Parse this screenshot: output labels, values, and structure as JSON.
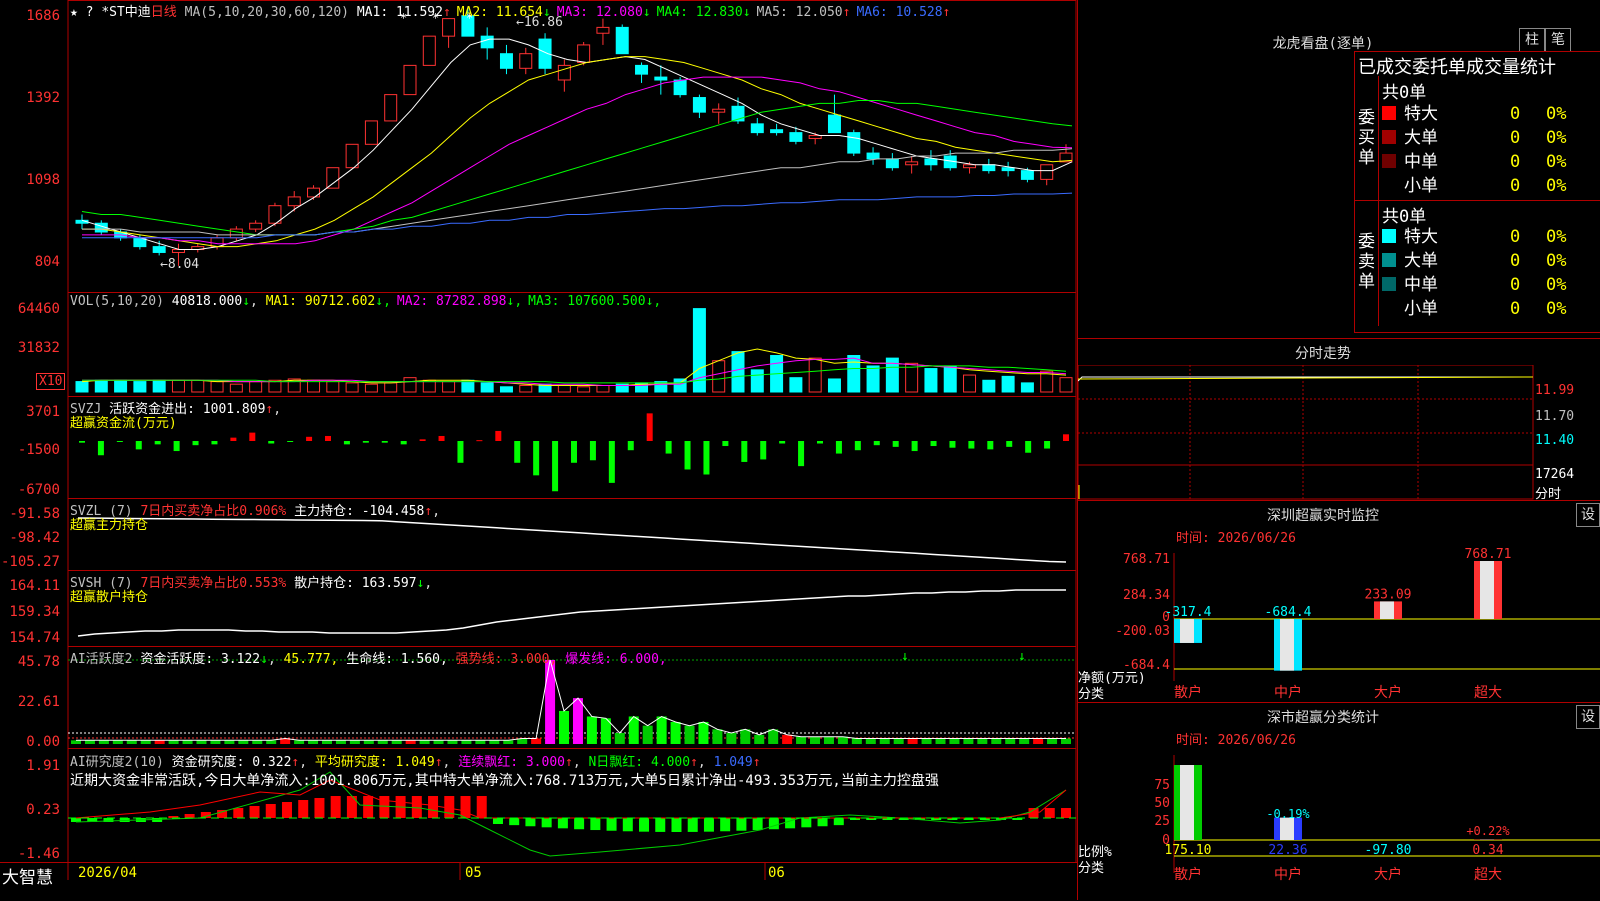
{
  "app": {
    "brand": "大智慧",
    "top_icons": "★ ?"
  },
  "colors": {
    "up": "#ff3232",
    "down": "#00ffff",
    "ma1": "#ffffff",
    "ma2": "#ffff00",
    "ma3": "#ff00ff",
    "ma4": "#00ff00",
    "ma5": "#c0c0c0",
    "ma6": "#3a6bff",
    "border": "#b00000"
  },
  "kline": {
    "stock": "*ST中迪",
    "period": "日线",
    "ma_header": "MA(5,10,20,30,60,120)",
    "ma_values": [
      {
        "label": "MA1:",
        "value": "11.592",
        "arrow": "↑"
      },
      {
        "label": "MA2:",
        "value": "11.654",
        "arrow": "↓"
      },
      {
        "label": "MA3:",
        "value": "12.080",
        "arrow": "↓"
      },
      {
        "label": "MA4:",
        "value": "12.830",
        "arrow": "↓"
      },
      {
        "label": "MA5:",
        "value": "12.050",
        "arrow": "↑"
      },
      {
        "label": "MA6:",
        "value": "10.528",
        "arrow": "↑"
      }
    ],
    "y_labels": [
      "1686",
      "1392",
      "1098",
      "804"
    ],
    "high_mark": "16.86",
    "low_mark": "8.04",
    "candles": [
      [
        9.6,
        9.8,
        9.3,
        9.5
      ],
      [
        9.5,
        9.6,
        9.1,
        9.2
      ],
      [
        9.2,
        9.3,
        8.9,
        9.0
      ],
      [
        9.0,
        9.1,
        8.6,
        8.7
      ],
      [
        8.7,
        8.9,
        8.4,
        8.5
      ],
      [
        8.5,
        8.8,
        8.04,
        8.6
      ],
      [
        8.6,
        8.8,
        8.5,
        8.7
      ],
      [
        8.7,
        9.1,
        8.6,
        9.0
      ],
      [
        9.0,
        9.4,
        8.9,
        9.3
      ],
      [
        9.3,
        9.6,
        9.2,
        9.5
      ],
      [
        9.5,
        10.2,
        9.4,
        10.1
      ],
      [
        10.1,
        10.6,
        9.9,
        10.4
      ],
      [
        10.4,
        10.8,
        10.3,
        10.7
      ],
      [
        10.7,
        11.4,
        10.7,
        11.4
      ],
      [
        11.4,
        12.2,
        11.4,
        12.2
      ],
      [
        12.2,
        13.0,
        12.2,
        13.0
      ],
      [
        13.0,
        13.9,
        13.0,
        13.9
      ],
      [
        13.9,
        14.9,
        13.9,
        14.9
      ],
      [
        14.9,
        15.9,
        14.9,
        15.9
      ],
      [
        15.9,
        16.5,
        15.5,
        16.5
      ],
      [
        16.6,
        16.86,
        15.9,
        15.9
      ],
      [
        15.9,
        16.2,
        15.1,
        15.5
      ],
      [
        15.3,
        15.6,
        14.6,
        14.8
      ],
      [
        14.8,
        15.5,
        14.6,
        15.3
      ],
      [
        15.8,
        16.0,
        14.6,
        14.8
      ],
      [
        14.4,
        15.1,
        14.0,
        14.9
      ],
      [
        15.0,
        15.7,
        14.9,
        15.6
      ],
      [
        16.0,
        16.5,
        15.6,
        16.2
      ],
      [
        16.2,
        16.3,
        15.3,
        15.3
      ],
      [
        14.9,
        15.0,
        14.3,
        14.6
      ],
      [
        14.5,
        14.9,
        13.9,
        14.4
      ],
      [
        14.4,
        14.5,
        13.8,
        13.9
      ],
      [
        13.8,
        13.9,
        13.1,
        13.3
      ],
      [
        13.3,
        13.6,
        12.9,
        13.4
      ],
      [
        13.5,
        13.8,
        12.9,
        13.0
      ],
      [
        12.9,
        13.1,
        12.5,
        12.6
      ],
      [
        12.7,
        12.9,
        12.5,
        12.6
      ],
      [
        12.6,
        12.8,
        12.2,
        12.3
      ],
      [
        12.4,
        12.6,
        12.2,
        12.5
      ],
      [
        13.2,
        13.9,
        12.6,
        12.6
      ],
      [
        12.6,
        12.7,
        11.8,
        11.9
      ],
      [
        11.9,
        12.1,
        11.5,
        11.7
      ],
      [
        11.7,
        11.9,
        11.3,
        11.4
      ],
      [
        11.5,
        11.8,
        11.2,
        11.6
      ],
      [
        11.7,
        12.0,
        11.3,
        11.5
      ],
      [
        11.8,
        12.0,
        11.3,
        11.4
      ],
      [
        11.4,
        11.6,
        11.2,
        11.5
      ],
      [
        11.5,
        11.7,
        11.2,
        11.3
      ],
      [
        11.4,
        11.6,
        11.1,
        11.3
      ],
      [
        11.3,
        11.4,
        10.9,
        11.0
      ],
      [
        11.0,
        11.5,
        10.8,
        11.5
      ],
      [
        11.6,
        12.2,
        11.6,
        11.9
      ]
    ],
    "ma_series": {
      "ma1": [
        9.6,
        9.4,
        9.2,
        9.0,
        8.8,
        8.6,
        8.6,
        8.7,
        8.9,
        9.1,
        9.5,
        10.0,
        10.4,
        10.9,
        11.4,
        12.0,
        12.7,
        13.4,
        14.2,
        15.0,
        15.6,
        15.8,
        15.8,
        15.6,
        15.3,
        15.1,
        15.0,
        15.1,
        15.2,
        15.1,
        14.8,
        14.5,
        14.2,
        13.9,
        13.6,
        13.2,
        12.9,
        12.7,
        12.5,
        12.5,
        12.4,
        12.2,
        12.0,
        11.8,
        11.7,
        11.6,
        11.5,
        11.5,
        11.4,
        11.3,
        11.3,
        11.6
      ],
      "ma2": [
        9.3,
        9.3,
        9.2,
        9.1,
        9.0,
        8.9,
        8.8,
        8.7,
        8.7,
        8.8,
        8.9,
        9.1,
        9.3,
        9.6,
        10.0,
        10.4,
        10.9,
        11.4,
        11.9,
        12.5,
        13.1,
        13.6,
        14.0,
        14.4,
        14.6,
        14.8,
        15.0,
        15.1,
        15.2,
        15.2,
        15.1,
        15.0,
        14.8,
        14.6,
        14.4,
        14.1,
        13.9,
        13.6,
        13.4,
        13.2,
        13.0,
        12.8,
        12.6,
        12.4,
        12.3,
        12.1,
        12.0,
        11.9,
        11.8,
        11.7,
        11.6,
        11.65
      ],
      "ma3": [
        9.1,
        9.1,
        9.1,
        9.0,
        9.0,
        8.9,
        8.9,
        8.8,
        8.8,
        8.8,
        8.8,
        8.8,
        8.9,
        9.1,
        9.3,
        9.6,
        9.9,
        10.2,
        10.6,
        11.0,
        11.4,
        11.8,
        12.2,
        12.5,
        12.8,
        13.1,
        13.4,
        13.6,
        13.9,
        14.1,
        14.3,
        14.4,
        14.5,
        14.5,
        14.5,
        14.5,
        14.4,
        14.3,
        14.1,
        14.0,
        13.8,
        13.6,
        13.4,
        13.2,
        13.0,
        12.8,
        12.6,
        12.5,
        12.3,
        12.2,
        12.1,
        12.08
      ],
      "ma4": [
        9.9,
        9.8,
        9.8,
        9.7,
        9.6,
        9.5,
        9.4,
        9.3,
        9.2,
        9.1,
        9.1,
        9.1,
        9.1,
        9.2,
        9.3,
        9.4,
        9.6,
        9.7,
        9.9,
        10.1,
        10.3,
        10.5,
        10.7,
        10.9,
        11.1,
        11.3,
        11.5,
        11.7,
        11.9,
        12.1,
        12.3,
        12.5,
        12.7,
        12.9,
        13.1,
        13.3,
        13.4,
        13.5,
        13.6,
        13.6,
        13.7,
        13.7,
        13.6,
        13.6,
        13.5,
        13.4,
        13.3,
        13.2,
        13.1,
        13.0,
        12.9,
        12.83
      ],
      "ma5": [
        9.3,
        9.3,
        9.3,
        9.2,
        9.2,
        9.2,
        9.2,
        9.1,
        9.1,
        9.1,
        9.1,
        9.1,
        9.1,
        9.2,
        9.2,
        9.3,
        9.4,
        9.5,
        9.6,
        9.7,
        9.8,
        9.9,
        10.0,
        10.1,
        10.2,
        10.3,
        10.4,
        10.5,
        10.6,
        10.7,
        10.8,
        10.9,
        11.0,
        11.1,
        11.2,
        11.3,
        11.4,
        11.4,
        11.5,
        11.6,
        11.6,
        11.7,
        11.7,
        11.8,
        11.8,
        11.9,
        11.9,
        11.9,
        12.0,
        12.0,
        12.0,
        12.05
      ],
      "ma6": [
        9.0,
        9.0,
        9.0,
        9.0,
        9.0,
        9.0,
        9.0,
        9.0,
        9.0,
        9.0,
        9.1,
        9.1,
        9.1,
        9.2,
        9.2,
        9.3,
        9.3,
        9.4,
        9.4,
        9.5,
        9.5,
        9.6,
        9.6,
        9.7,
        9.7,
        9.8,
        9.8,
        9.85,
        9.9,
        9.95,
        10.0,
        10.0,
        10.05,
        10.1,
        10.1,
        10.15,
        10.2,
        10.2,
        10.25,
        10.3,
        10.3,
        10.3,
        10.35,
        10.4,
        10.4,
        10.4,
        10.45,
        10.45,
        10.5,
        10.5,
        10.5,
        10.53
      ]
    }
  },
  "vol": {
    "header": "VOL(5,10,20)",
    "val": "40818.000",
    "ma": [
      {
        "label": "MA1:",
        "value": "90712.602",
        "arrow": "↓"
      },
      {
        "label": "MA2:",
        "value": "87282.898",
        "arrow": "↓"
      },
      {
        "label": "MA3:",
        "value": "107600.500",
        "arrow": "↓"
      }
    ],
    "y_labels": [
      "64460",
      "31832"
    ],
    "unit": "X10",
    "bars": [
      8,
      9,
      9,
      8,
      9,
      9,
      9,
      8,
      6,
      8,
      9,
      10,
      9,
      8,
      7,
      6,
      7,
      11,
      9,
      8,
      9,
      7,
      4,
      5,
      6,
      5,
      4,
      5,
      6,
      7,
      8,
      10,
      64,
      24,
      31,
      17,
      28,
      11,
      26,
      10,
      28,
      20,
      26,
      22,
      18,
      20,
      13,
      9,
      12,
      7,
      16,
      11
    ]
  },
  "svzj": {
    "header": "SVZJ",
    "line1": "活跃资金进出: 1001.809",
    "line2": "超赢资金流(万元)",
    "y_labels": [
      "3701",
      "-1500",
      "-6700"
    ],
    "values": [
      -200,
      -1700,
      -100,
      -1000,
      -400,
      -1200,
      -500,
      -400,
      400,
      1000,
      -300,
      -100,
      500,
      600,
      -400,
      -200,
      -200,
      -400,
      200,
      600,
      -2600,
      100,
      1200,
      -2600,
      -4100,
      -6000,
      -2600,
      -2300,
      -5000,
      -1100,
      3300,
      -1500,
      -3400,
      -4000,
      -600,
      -2500,
      -2200,
      -300,
      -3000,
      -300,
      -1500,
      -1100,
      -500,
      -700,
      -1200,
      -600,
      -800,
      -900,
      -1000,
      -700,
      -1400,
      -900,
      800
    ]
  },
  "svzl": {
    "header": "SVZL (7)",
    "line1a": "7日内买卖净占比0.906%",
    "line1b": "主力持仓: -104.458",
    "line2": "超赢主力持仓",
    "y_labels": [
      "-91.58",
      "-98.42",
      "-105.27"
    ]
  },
  "svsh": {
    "header": "SVSH (7)",
    "line1a": "7日内买卖净占比0.553%",
    "line1b": "散户持仓: 163.597",
    "line2": "超赢散户持仓",
    "y_labels": [
      "164.11",
      "159.34",
      "154.74"
    ]
  },
  "ai_act": {
    "header": "AI活跃度2",
    "val1": "资金活跃度: 3.122",
    "val2": "45.777,",
    "val3": "生命线: 1.560,",
    "val4": "强势线: 3.000,",
    "val5": "爆发线: 6.000,",
    "y_labels": [
      "45.78",
      "22.61",
      "0.00"
    ],
    "values": [
      2,
      2,
      2,
      2,
      2,
      2,
      2,
      2,
      2,
      2,
      2,
      2,
      2,
      2,
      2,
      3,
      2,
      2,
      2,
      2,
      2,
      2,
      2,
      2,
      2,
      2,
      2,
      2,
      2,
      2,
      2,
      2,
      3,
      3,
      45.8,
      18,
      25,
      15,
      14,
      6,
      15,
      10,
      15,
      12,
      10,
      12,
      8,
      6,
      8,
      5,
      8,
      5,
      4,
      4,
      4,
      4,
      3,
      3,
      3,
      3,
      3,
      3,
      3,
      3,
      3,
      3,
      3,
      3,
      3,
      3,
      3,
      3
    ]
  },
  "ai_res": {
    "header": "AI研究度2(10)",
    "val1": "资金研究度: 0.322",
    "val2": "平均研究度: 1.049",
    "val3": "连续飘红: 3.000",
    "val4": "N日飘红: 4.000",
    "val5": "1.049",
    "comment": "近期大资金非常活跃,今日大单净流入:1001.806万元,其中特大单净流入:768.713万元,大单5日累计净出-493.353万元,当前主力控盘强",
    "y_labels": [
      "1.91",
      "0.23",
      "-1.46"
    ]
  },
  "xaxis": {
    "labels": [
      "2026/04",
      "05",
      "06"
    ]
  },
  "right": {
    "lhb": {
      "title": "龙虎看盘(逐单)",
      "btn_a": "柱",
      "btn_b": "笔",
      "subtitle": "已成交委托单成交量统计",
      "buy_label": "委买单",
      "sell_label": "委卖单",
      "buy_count": "共0单",
      "sell_count": "共0单",
      "rows_buy": [
        {
          "name": "特大",
          "n": "0",
          "p": "0%",
          "color": "#ff0000"
        },
        {
          "name": "大单",
          "n": "0",
          "p": "0%",
          "color": "#a00000"
        },
        {
          "name": "中单",
          "n": "0",
          "p": "0%",
          "color": "#700000"
        },
        {
          "name": "小单",
          "n": "0",
          "p": "0%",
          "color": ""
        }
      ],
      "rows_sell": [
        {
          "name": "特大",
          "n": "0",
          "p": "0%",
          "color": "#00ffff"
        },
        {
          "name": "大单",
          "n": "0",
          "p": "0%",
          "color": "#009090"
        },
        {
          "name": "中单",
          "n": "0",
          "p": "0%",
          "color": "#006868"
        },
        {
          "name": "小单",
          "n": "0",
          "p": "0%",
          "color": ""
        }
      ]
    },
    "fenshi": {
      "title": "分时走势",
      "y1": "11.99",
      "y2": "11.70",
      "y3": "11.40",
      "vol": "17264",
      "unit": "分时"
    },
    "sz_monitor": {
      "title": "深圳超赢实时监控",
      "btn": "设",
      "time": "时间: 2026/06/26",
      "y_labels": [
        "768.71",
        "284.34",
        "0",
        "-200.03",
        "-684.4"
      ],
      "axis_label": "净额(万元)",
      "axis_label2": "分类",
      "bars": [
        {
          "cat": "散户",
          "value": -317.4,
          "label": "-317.4"
        },
        {
          "cat": "中户",
          "value": -684.4,
          "label": "-684.4"
        },
        {
          "cat": "大户",
          "value": 233.09,
          "label": "233.09"
        },
        {
          "cat": "超大",
          "value": 768.71,
          "label": "768.71"
        }
      ]
    },
    "sz_class": {
      "title": "深市超赢分类统计",
      "btn": "设",
      "time": "时间: 2026/06/26",
      "y_labels": [
        "75",
        "50",
        "25",
        "0"
      ],
      "axis_label": "比例%",
      "axis_label2": "分类",
      "bars": [
        {
          "cat": "散户",
          "value": 175.1,
          "label": "175.10",
          "pct": ""
        },
        {
          "cat": "中户",
          "value": 22.36,
          "label": "22.36",
          "pct": "-0.19%"
        },
        {
          "cat": "大户",
          "value": -97.8,
          "label": "-97.80",
          "pct": ""
        },
        {
          "cat": "超大",
          "value": 0.34,
          "label": "0.34",
          "pct": "+0.22%"
        }
      ]
    }
  }
}
